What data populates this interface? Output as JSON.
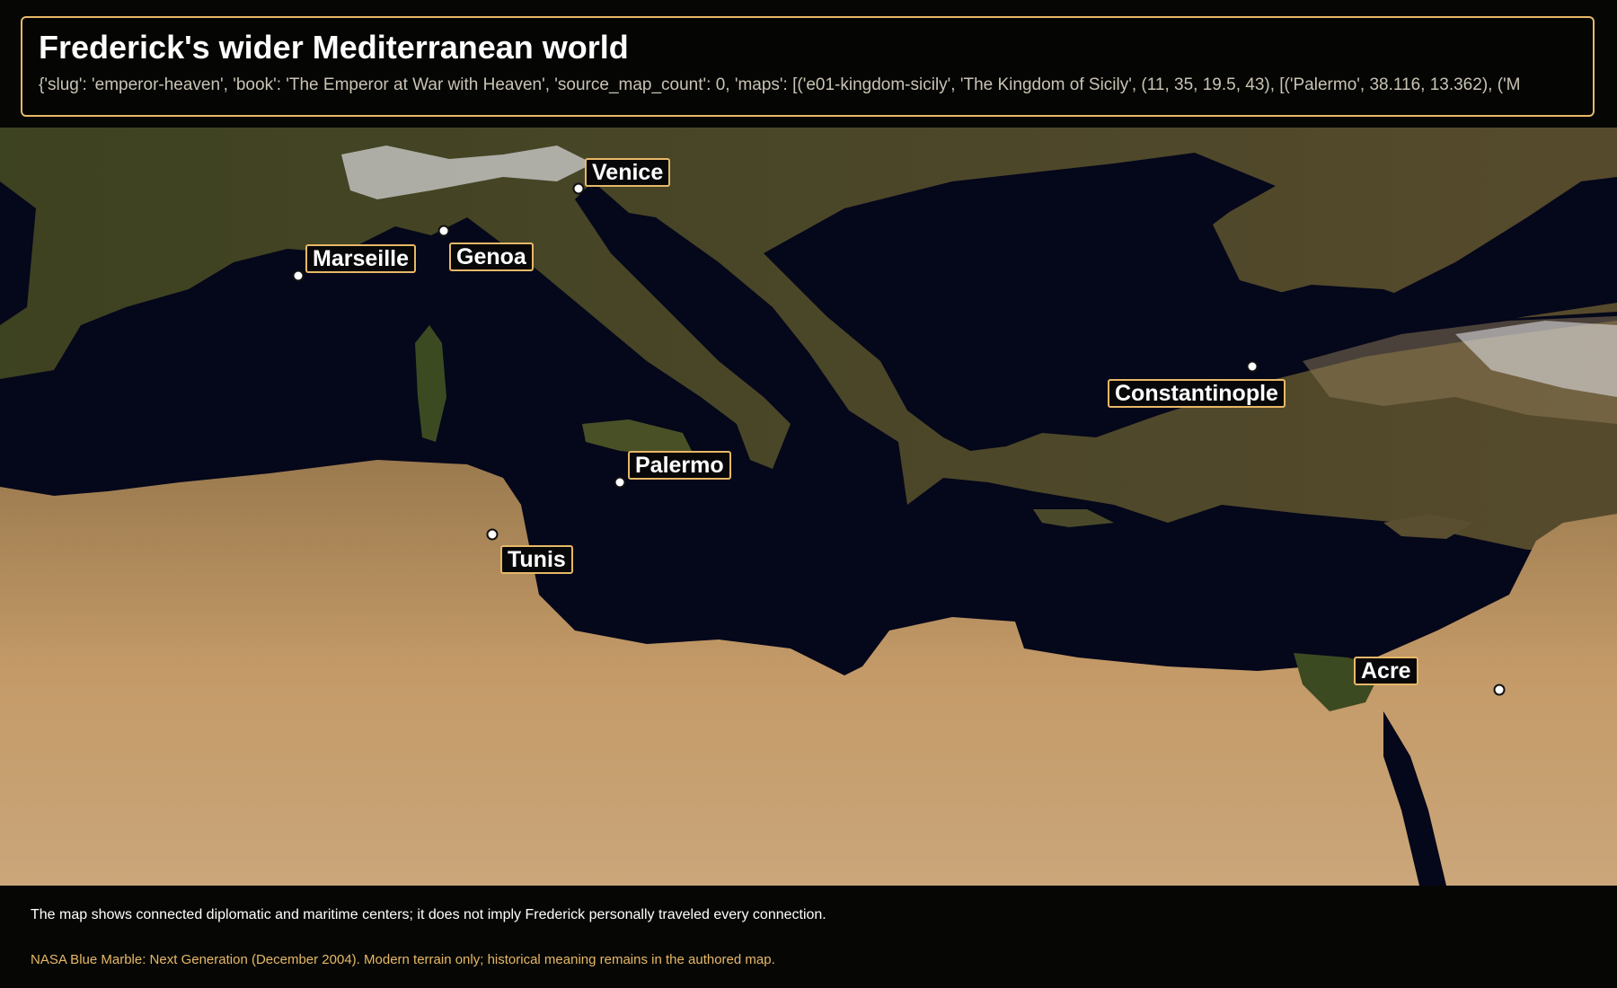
{
  "header": {
    "title": "Frederick's wider Mediterranean world",
    "subtitle": "{'slug': 'emperor-heaven', 'book': 'The Emperor at War with Heaven', 'source_map_count': 0, 'maps': [('e01-kingdom-sicily', 'The Kingdom of Sicily', (11, 35, 19.5, 43), [('Palermo', 38.116, 13.362), ('M"
  },
  "map": {
    "places": [
      {
        "id": "venice",
        "label": "Venice"
      },
      {
        "id": "genoa",
        "label": "Genoa"
      },
      {
        "id": "marseille",
        "label": "Marseille"
      },
      {
        "id": "constantinople",
        "label": "Constantinople"
      },
      {
        "id": "palermo",
        "label": "Palermo"
      },
      {
        "id": "tunis",
        "label": "Tunis"
      },
      {
        "id": "acre",
        "label": "Acre"
      }
    ]
  },
  "footer": {
    "note": "The map shows connected diplomatic and maritime centers; it does not imply Frederick personally traveled every connection.",
    "credit": "NASA Blue Marble: Next Generation (December 2004). Modern terrain only; historical meaning remains in the authored map."
  }
}
